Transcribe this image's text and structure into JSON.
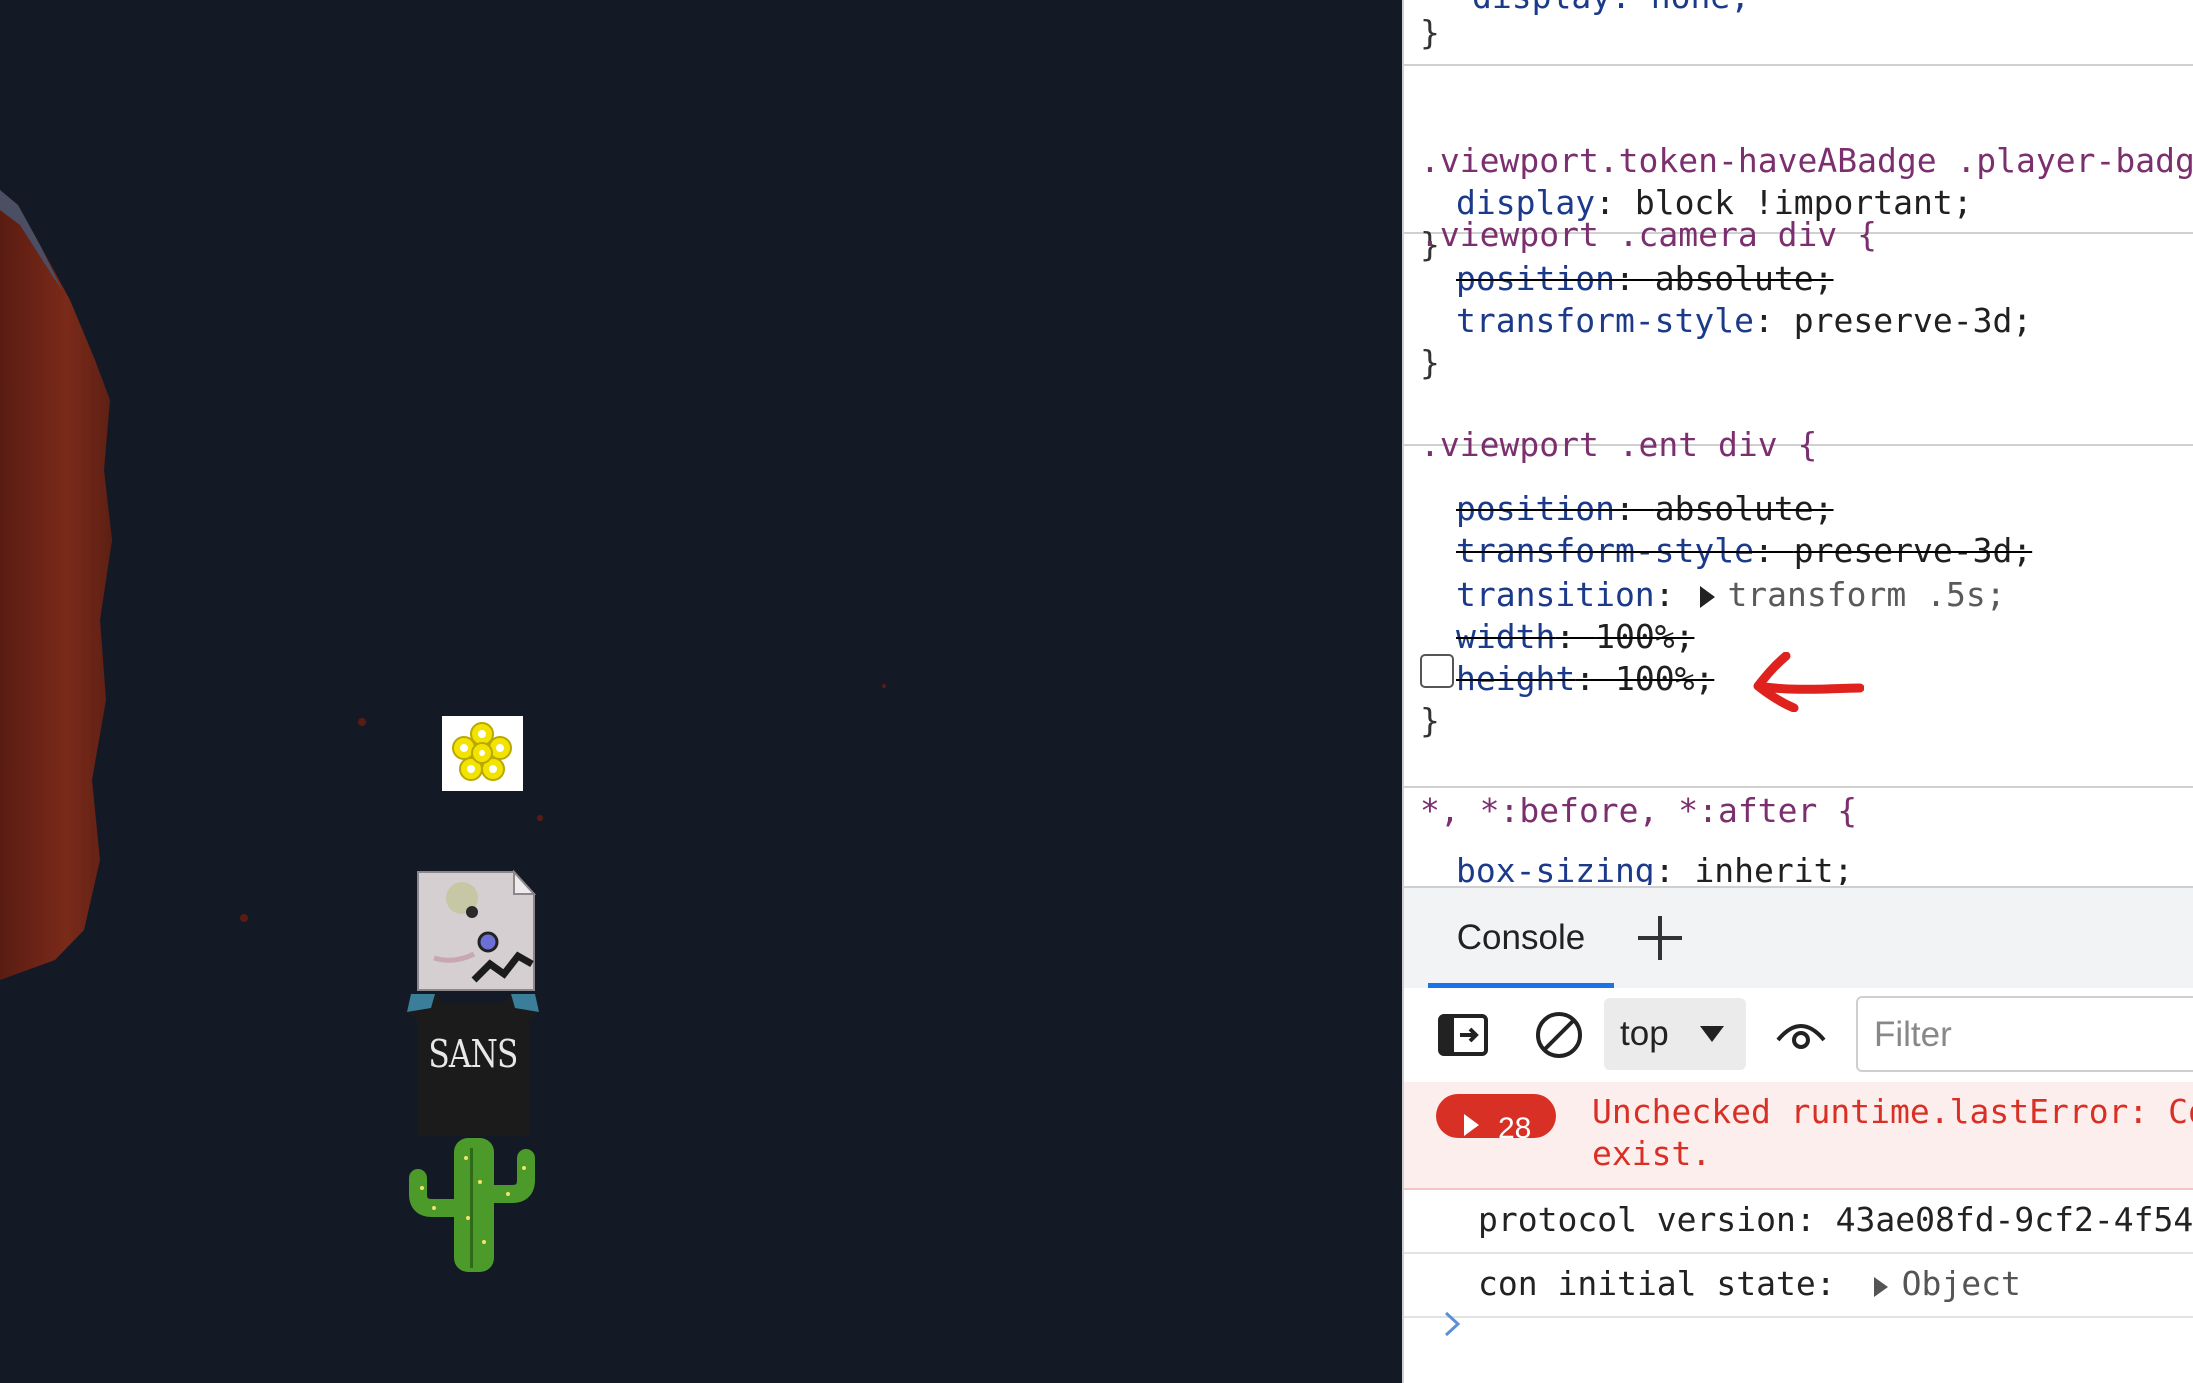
{
  "game": {
    "player_shirt_text": "SANS"
  },
  "styles": {
    "top_rule": {
      "declaration": "display: none;",
      "close": "}"
    },
    "rules": [
      {
        "selector": ".viewport.token-haveABadge .player-badge {",
        "declarations": [
          {
            "prop": "display",
            "value": "block !important;",
            "struck": false
          }
        ],
        "close": "}"
      },
      {
        "selector": ".viewport .camera div {",
        "declarations": [
          {
            "prop": "position",
            "value": "absolute;",
            "struck": true
          },
          {
            "prop": "transform-style",
            "value": "preserve-3d;",
            "struck": false
          }
        ],
        "close": "}"
      },
      {
        "selector": ".viewport .ent div {",
        "declarations": [
          {
            "prop": "position",
            "value": "absolute;",
            "struck": true
          },
          {
            "prop": "transform-style",
            "value": "preserve-3d;",
            "struck": true
          },
          {
            "prop": "transition",
            "value": "transform .5s;",
            "struck": false
          },
          {
            "prop": "width",
            "value": "100%;",
            "struck": true
          },
          {
            "prop": "height",
            "value": "100%;",
            "struck": true
          }
        ],
        "close": "}"
      },
      {
        "selector": "*, *:before, *:after {",
        "declarations": [
          {
            "prop": "box-sizing",
            "value": "inherit;",
            "struck": false
          }
        ]
      }
    ]
  },
  "drawer": {
    "tab_console": "Console",
    "context": "top",
    "filter_placeholder": "Filter"
  },
  "console": {
    "error_count": "28",
    "error_line1": "Unchecked runtime.lastError: Co",
    "error_line2": "exist.",
    "log1": "protocol version: 43ae08fd-9cf2-4f54",
    "log2_label": "con initial state:",
    "log2_object": "Object"
  },
  "annotation": {
    "arrow_color": "#e0221f"
  },
  "colors": {
    "viewport_bg": "#141a25",
    "rock": "#6e2417",
    "error_red": "#d93025",
    "selector_purple": "#7b2f6e",
    "property_blue": "#1b3a8a",
    "tab_accent": "#1a73e8"
  }
}
